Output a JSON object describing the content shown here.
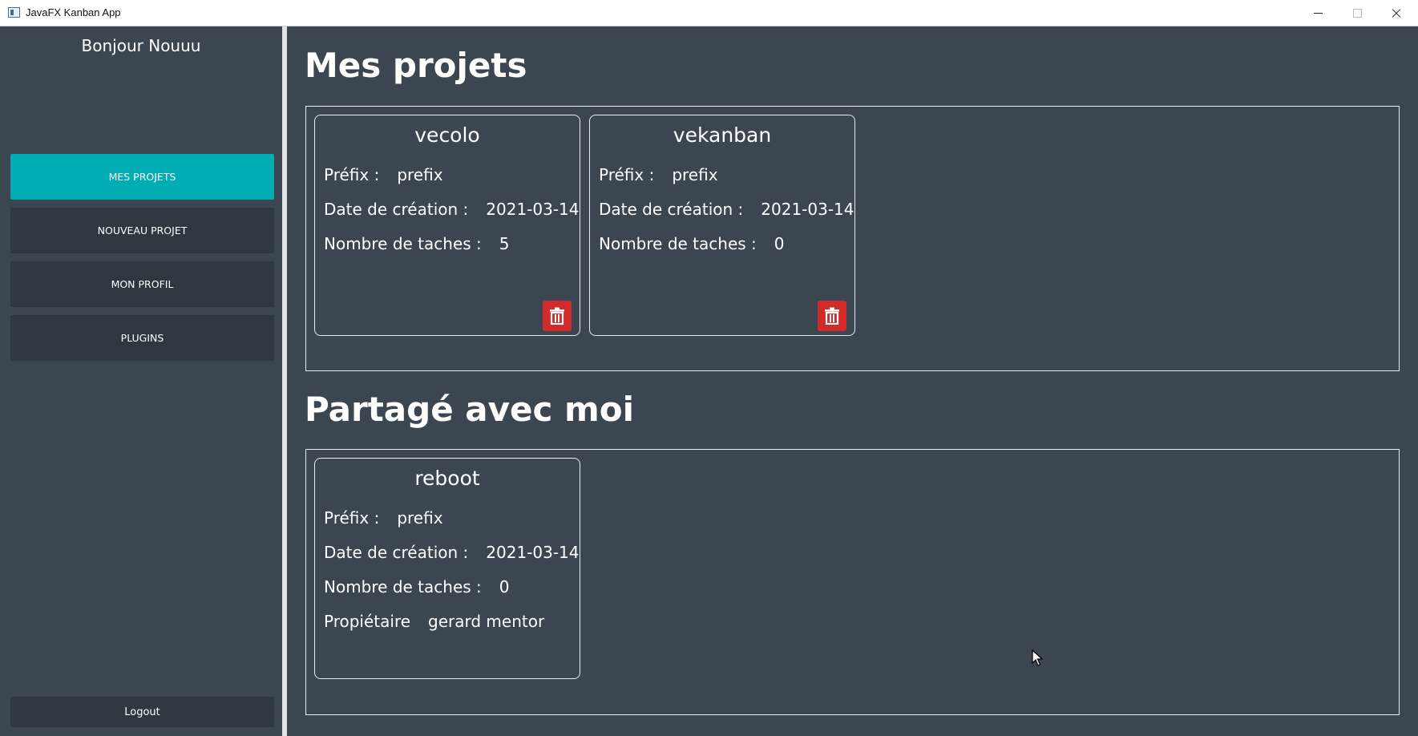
{
  "window": {
    "title": "JavaFX Kanban App"
  },
  "sidebar": {
    "greeting": "Bonjour Nouuu",
    "items": [
      {
        "label": "MES PROJETS",
        "active": true
      },
      {
        "label": "NOUVEAU PROJET",
        "active": false
      },
      {
        "label": "MON PROFIL",
        "active": false
      },
      {
        "label": "PLUGINS",
        "active": false
      }
    ],
    "logout_label": "Logout"
  },
  "main": {
    "my_projects_title": "Mes projets",
    "shared_title": "Partagé avec moi",
    "labels": {
      "prefix": "Préfix :",
      "created": "Date de création :",
      "tasks": "Nombre de taches :",
      "owner": "Propiétaire"
    },
    "my_projects": [
      {
        "name": "vecolo",
        "prefix": "prefix",
        "created": "2021-03-14",
        "tasks": "5"
      },
      {
        "name": "vekanban",
        "prefix": "prefix",
        "created": "2021-03-14",
        "tasks": "0"
      }
    ],
    "shared_projects": [
      {
        "name": "reboot",
        "prefix": "prefix",
        "created": "2021-03-14",
        "tasks": "0",
        "owner": "gerard mentor"
      }
    ]
  },
  "colors": {
    "background": "#3b4650",
    "button": "#2f3740",
    "accent": "#00adb5",
    "delete": "#d22b2b"
  },
  "icons": [
    "app-icon",
    "minimize-icon",
    "maximize-icon",
    "close-icon",
    "trash-icon",
    "cursor-icon"
  ]
}
